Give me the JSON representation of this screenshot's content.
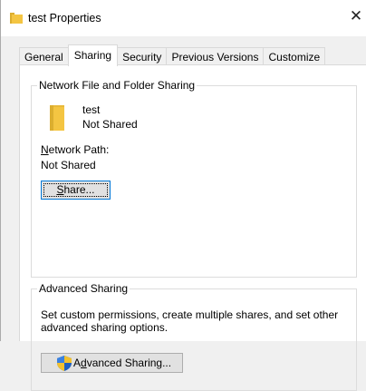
{
  "window": {
    "title": "test Properties",
    "close_glyph": "✕"
  },
  "tabs": [
    {
      "label": "General",
      "active": false
    },
    {
      "label": "Sharing",
      "active": true
    },
    {
      "label": "Security",
      "active": false
    },
    {
      "label": "Previous Versions",
      "active": false
    },
    {
      "label": "Customize",
      "active": false
    }
  ],
  "network_sharing": {
    "legend": "Network File and Folder Sharing",
    "folder_name": "test",
    "folder_state": "Not Shared",
    "network_path_label_prefix": "N",
    "network_path_label_rest": "etwork Path:",
    "network_path_value": "Not Shared",
    "share_button_prefix": "S",
    "share_button_rest": "hare..."
  },
  "advanced_sharing": {
    "legend": "Advanced Sharing",
    "description": "Set custom permissions, create multiple shares, and set other advanced sharing options.",
    "button_prefix": "A",
    "button_accel": "d",
    "button_rest": "vanced Sharing..."
  },
  "icons": {
    "title": "folder-icon",
    "folder": "folder-icon",
    "uac": "uac-shield-icon",
    "close": "close-icon"
  },
  "colors": {
    "folder_yellow": "#f4c542",
    "folder_yellow_dark": "#dcae2f",
    "focus_blue": "#0078d7"
  }
}
